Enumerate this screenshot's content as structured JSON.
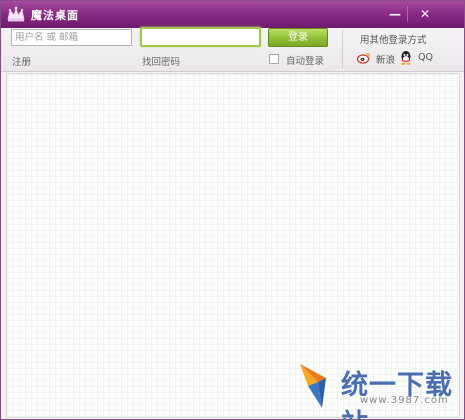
{
  "window": {
    "title": "魔法桌面",
    "minimize_symbol": "—",
    "close_symbol": "✕",
    "accent": "#8a2c86"
  },
  "login": {
    "username_placeholder": "用户名 或 邮箱",
    "username_value": "",
    "password_value": "",
    "login_button": "登录",
    "register_link": "注册",
    "forgot_link": "找回密码",
    "auto_login_label": "自动登录",
    "auto_login_checked": false,
    "other_methods_label": "用其他登录方式",
    "providers": [
      {
        "icon": "weibo-icon",
        "label": "新浪"
      },
      {
        "icon": "qq-icon",
        "label": "QQ"
      }
    ]
  },
  "watermark": {
    "text": "统一下载站",
    "url": "www.3987.com"
  }
}
